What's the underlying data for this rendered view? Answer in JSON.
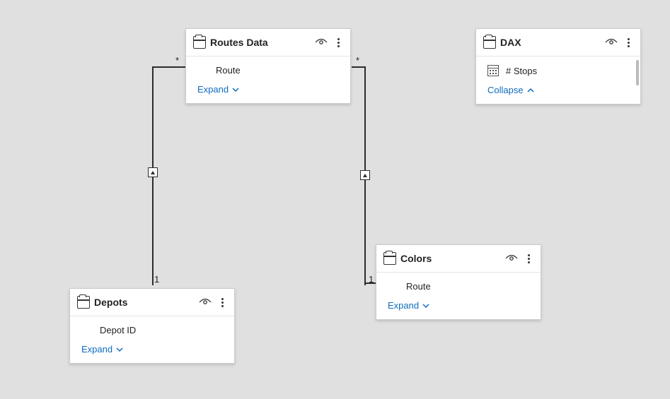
{
  "tables": {
    "routes": {
      "title": "Routes Data",
      "field": "Route",
      "action": "Expand"
    },
    "dax": {
      "title": "DAX",
      "field": "# Stops",
      "action": "Collapse"
    },
    "depots": {
      "title": "Depots",
      "field": "Depot ID",
      "action": "Expand"
    },
    "colors": {
      "title": "Colors",
      "field": "Route",
      "action": "Expand"
    }
  },
  "rel": {
    "many": "*",
    "one": "1"
  }
}
